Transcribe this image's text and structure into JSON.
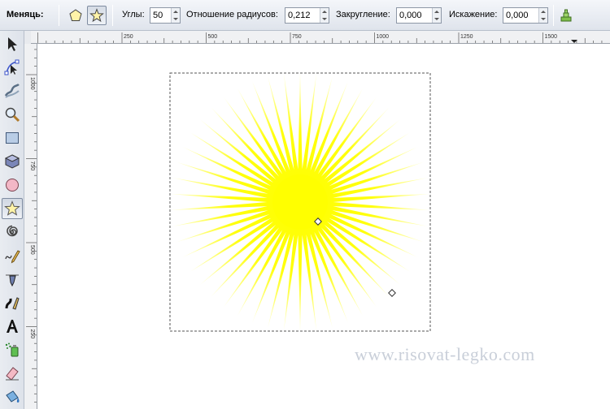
{
  "toolbar": {
    "change_label": "Меняць:",
    "polygon_icon": "polygon-icon",
    "star_icon": "star-icon",
    "corners": {
      "label": "Углы:",
      "value": "50"
    },
    "ratio": {
      "label": "Отношение радиусов:",
      "value": "0,212"
    },
    "rounding": {
      "label": "Закругление:",
      "value": "0,000"
    },
    "distortion": {
      "label": "Искажение:",
      "value": "0,000"
    },
    "reset_icon": "reset-defaults-icon"
  },
  "ruler": {
    "h_labels": [
      "250",
      "500",
      "750",
      "1000",
      "1250",
      "1500"
    ],
    "v_labels": [
      "1000",
      "750",
      "500",
      "250"
    ]
  },
  "tools": [
    {
      "name": "selector-tool",
      "icon": "arrow-icon",
      "active": false
    },
    {
      "name": "node-tool",
      "icon": "node-edit-icon",
      "active": false
    },
    {
      "name": "tweak-tool",
      "icon": "tweak-icon",
      "active": false
    },
    {
      "name": "zoom-tool",
      "icon": "zoom-icon",
      "active": false
    },
    {
      "name": "rect-tool",
      "icon": "rectangle-icon",
      "active": false
    },
    {
      "name": "3dbox-tool",
      "icon": "3d-box-icon",
      "active": false
    },
    {
      "name": "ellipse-tool",
      "icon": "ellipse-icon",
      "active": false
    },
    {
      "name": "star-tool",
      "icon": "star-icon",
      "active": true
    },
    {
      "name": "spiral-tool",
      "icon": "spiral-icon",
      "active": false
    },
    {
      "name": "pencil-tool",
      "icon": "pencil-icon",
      "active": false
    },
    {
      "name": "pen-tool",
      "icon": "pen-icon",
      "active": false
    },
    {
      "name": "calligraphy-tool",
      "icon": "calligraphy-icon",
      "active": false
    },
    {
      "name": "text-tool",
      "icon": "text-icon",
      "active": false
    },
    {
      "name": "spray-tool",
      "icon": "spray-icon",
      "active": false
    },
    {
      "name": "eraser-tool",
      "icon": "eraser-icon",
      "active": false
    },
    {
      "name": "bucket-tool",
      "icon": "paint-bucket-icon",
      "active": false
    }
  ],
  "canvas": {
    "star_color": "#ffff00",
    "star_corners": 50,
    "star_ratio": 0.212
  },
  "watermark": "www.risovat-legko.com"
}
